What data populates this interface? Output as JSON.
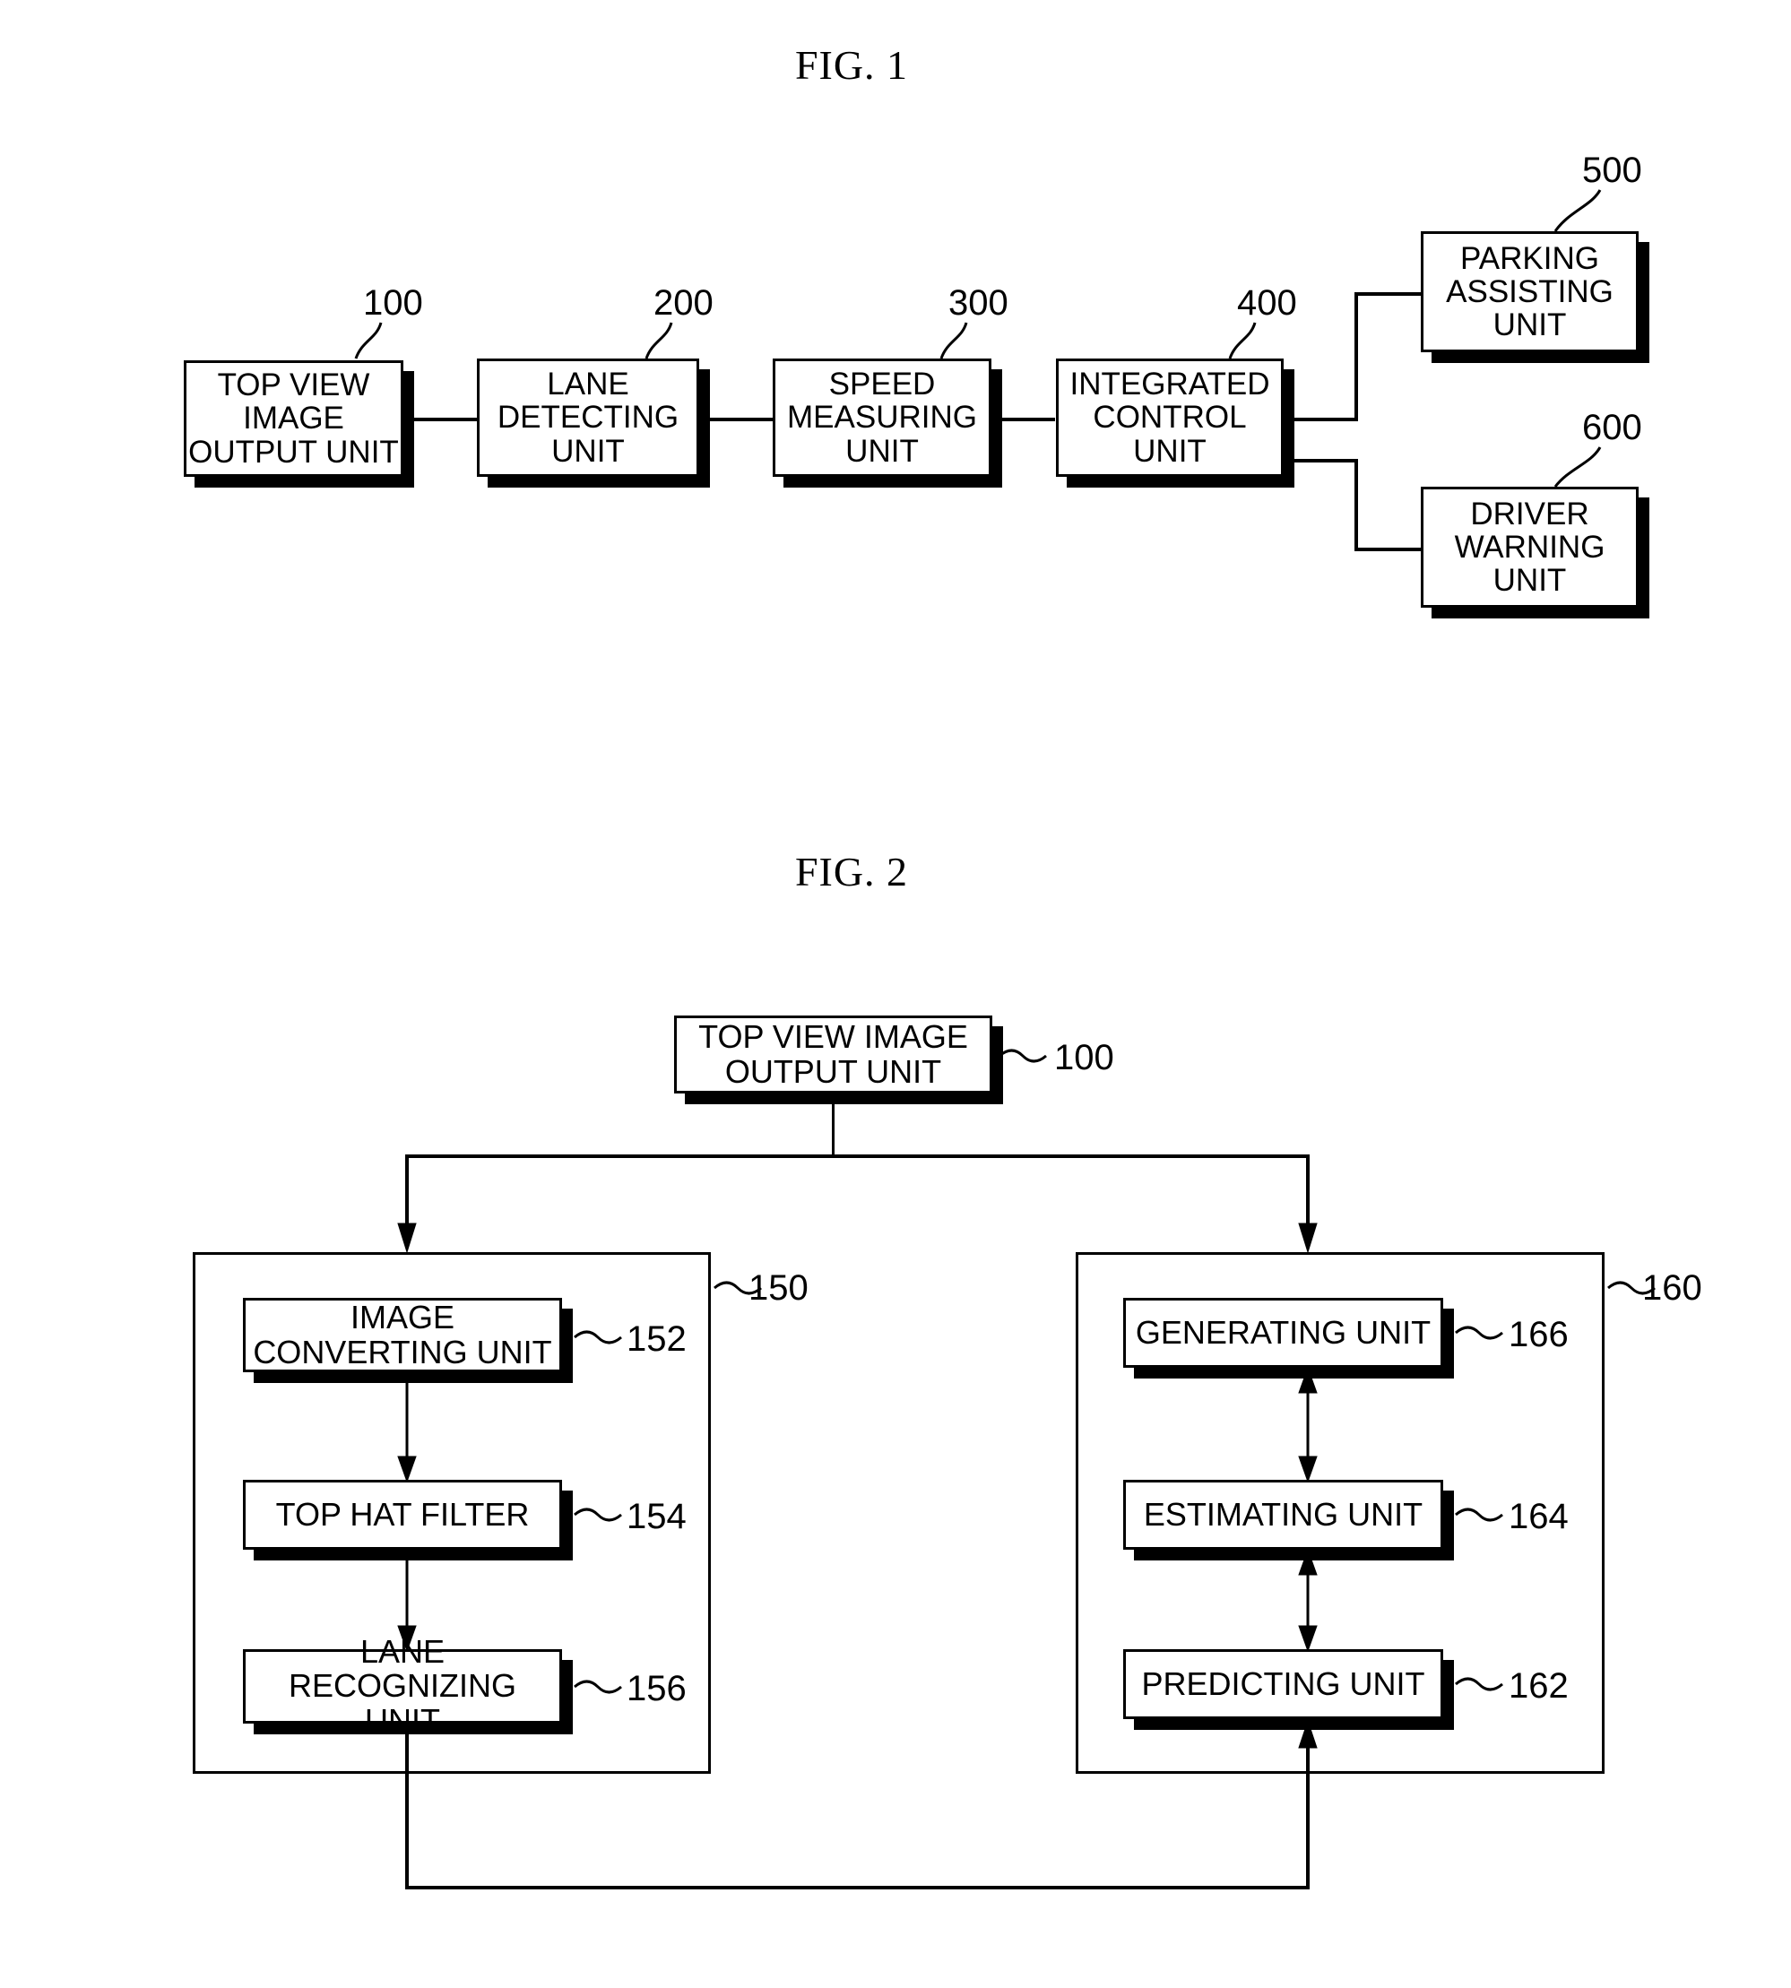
{
  "figures": [
    {
      "title": "FIG. 1",
      "blocks": [
        {
          "id": "b100",
          "label": "TOP VIEW\nIMAGE\nOUTPUT UNIT",
          "ref": "100"
        },
        {
          "id": "b200",
          "label": "LANE\nDETECTING\nUNIT",
          "ref": "200"
        },
        {
          "id": "b300",
          "label": "SPEED\nMEASURING\nUNIT",
          "ref": "300"
        },
        {
          "id": "b400",
          "label": "INTEGRATED\nCONTROL\nUNIT",
          "ref": "400"
        },
        {
          "id": "b500",
          "label": "PARKING\nASSISTING\nUNIT",
          "ref": "500"
        },
        {
          "id": "b600",
          "label": "DRIVER\nWARNING\nUNIT",
          "ref": "600"
        }
      ]
    },
    {
      "title": "FIG. 2",
      "blocks": [
        {
          "id": "b100b",
          "label": "TOP VIEW IMAGE\nOUTPUT UNIT",
          "ref": "100"
        },
        {
          "id": "c150",
          "label": "",
          "ref": "150"
        },
        {
          "id": "b152",
          "label": "IMAGE\nCONVERTING UNIT",
          "ref": "152"
        },
        {
          "id": "b154",
          "label": "TOP HAT FILTER",
          "ref": "154"
        },
        {
          "id": "b156",
          "label": "LANE RECOGNIZING\nUNIT",
          "ref": "156"
        },
        {
          "id": "c160",
          "label": "",
          "ref": "160"
        },
        {
          "id": "b166",
          "label": "GENERATING UNIT",
          "ref": "166"
        },
        {
          "id": "b164",
          "label": "ESTIMATING UNIT",
          "ref": "164"
        },
        {
          "id": "b162",
          "label": "PREDICTING UNIT",
          "ref": "162"
        }
      ]
    }
  ],
  "fig1": {
    "title": "FIG. 1",
    "top_view_image_output_unit": {
      "line1": "TOP VIEW",
      "line2": "IMAGE",
      "line3": "OUTPUT UNIT",
      "ref": "100"
    },
    "lane_detecting_unit": {
      "line1": "LANE",
      "line2": "DETECTING",
      "line3": "UNIT",
      "ref": "200"
    },
    "speed_measuring_unit": {
      "line1": "SPEED",
      "line2": "MEASURING",
      "line3": "UNIT",
      "ref": "300"
    },
    "integrated_control_unit": {
      "line1": "INTEGRATED",
      "line2": "CONTROL",
      "line3": "UNIT",
      "ref": "400"
    },
    "parking_assisting_unit": {
      "line1": "PARKING",
      "line2": "ASSISTING",
      "line3": "UNIT",
      "ref": "500"
    },
    "driver_warning_unit": {
      "line1": "DRIVER",
      "line2": "WARNING",
      "line3": "UNIT",
      "ref": "600"
    }
  },
  "fig2": {
    "title": "FIG. 2",
    "top_view_image_output_unit": {
      "line1": "TOP VIEW IMAGE",
      "line2": "OUTPUT UNIT",
      "ref": "100"
    },
    "lane_detecting_container": {
      "ref": "150"
    },
    "image_converting_unit": {
      "line1": "IMAGE",
      "line2": "CONVERTING UNIT",
      "ref": "152"
    },
    "top_hat_filter": {
      "line1": "TOP HAT FILTER",
      "ref": "154"
    },
    "lane_recognizing_unit": {
      "line1": "LANE RECOGNIZING",
      "line2": "UNIT",
      "ref": "156"
    },
    "speed_measuring_container": {
      "ref": "160"
    },
    "generating_unit": {
      "line1": "GENERATING UNIT",
      "ref": "166"
    },
    "estimating_unit": {
      "line1": "ESTIMATING UNIT",
      "ref": "164"
    },
    "predicting_unit": {
      "line1": "PREDICTING UNIT",
      "ref": "162"
    }
  },
  "colors": {
    "ink": "#000000",
    "paper": "#ffffff"
  }
}
